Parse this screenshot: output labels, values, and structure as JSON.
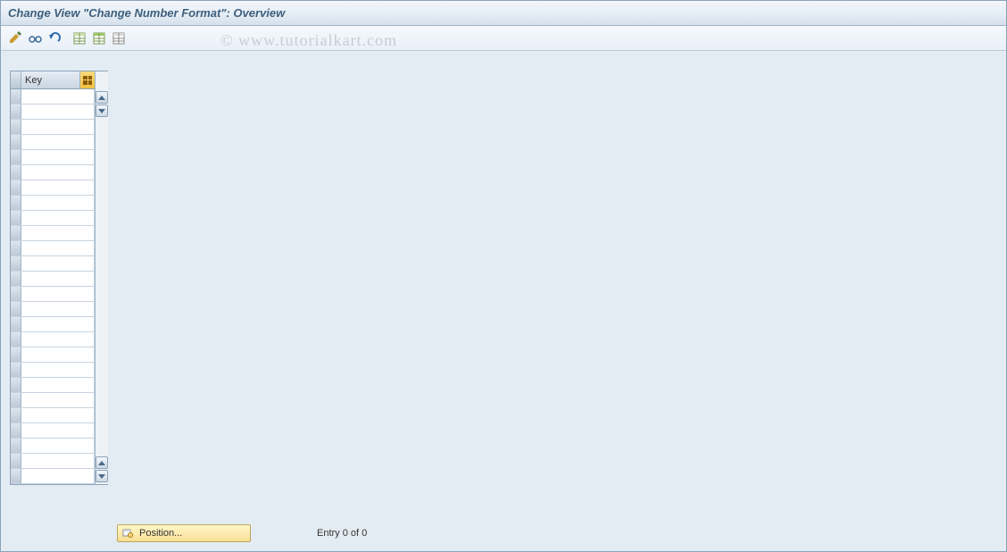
{
  "title": "Change View \"Change Number Format\": Overview",
  "watermark": "© www.tutorialkart.com",
  "toolbar": {
    "btn1": "change-other-view",
    "btn2": "display-details",
    "btn3": "undo",
    "btn4": "save",
    "btn5": "select-all",
    "btn6": "deselect-all"
  },
  "grid": {
    "header": "Key",
    "config_icon": "table-settings-icon"
  },
  "footer": {
    "position_label": "Position...",
    "entry_text": "Entry 0 of 0"
  }
}
